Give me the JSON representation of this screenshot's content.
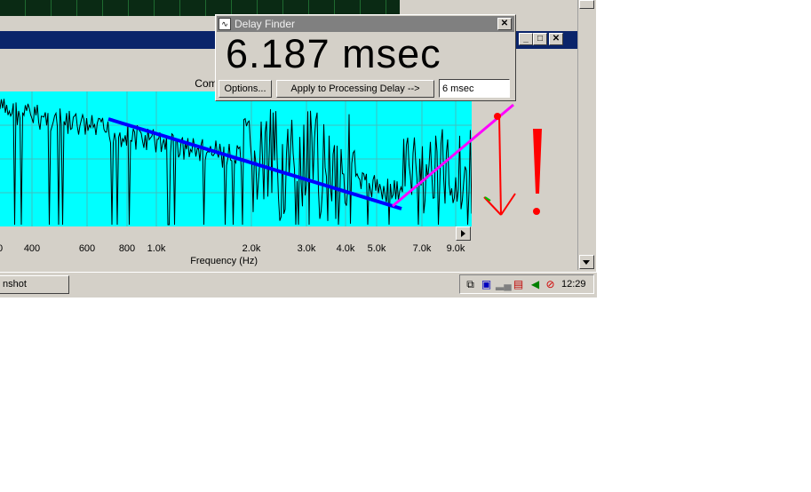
{
  "chart": {
    "title": "Complex Transfer Function (Left/Righ",
    "x_tick_labels": [
      "0",
      "400",
      "600",
      "800",
      "1.0k",
      "2.0k",
      "3.0k",
      "4.0k",
      "5.0k",
      "7.0k",
      "9.0k"
    ],
    "xlabel": "Frequency (Hz)"
  },
  "chart_data": {
    "type": "line",
    "title": "Complex Transfer Function (Left/Righ",
    "xlabel": "Frequency (Hz)",
    "ylabel": "",
    "x_scale": "log",
    "xlim": [
      300,
      10000
    ],
    "grid": true,
    "annotations": [
      {
        "type": "arrow-line",
        "color": "#0000ff",
        "from_hz": 700,
        "to_hz": 5800
      },
      {
        "type": "arrow-line",
        "color": "#ff00ff",
        "from_hz": 5500,
        "to_hz": 10000
      },
      {
        "type": "arrow",
        "color": "#ff0000",
        "direction": "down"
      },
      {
        "type": "exclamation",
        "color": "#ff0000"
      }
    ]
  },
  "dialog": {
    "title": "Delay Finder",
    "readout": "6.187 msec",
    "options_label": "Options...",
    "apply_label": "Apply to Processing Delay -->",
    "delay_value": "6 msec"
  },
  "taskbar": {
    "task_label": "nshot",
    "clock": "12:29"
  },
  "window": {
    "minimize": "_",
    "maximize": "□",
    "close": "✕"
  },
  "colors": {
    "plot_bg": "#00ffff",
    "title_active": "#0a246a",
    "title_inactive": "#808080",
    "annotation_blue": "#0000ff",
    "annotation_magenta": "#ff00ff",
    "annotation_red": "#ff0000"
  }
}
